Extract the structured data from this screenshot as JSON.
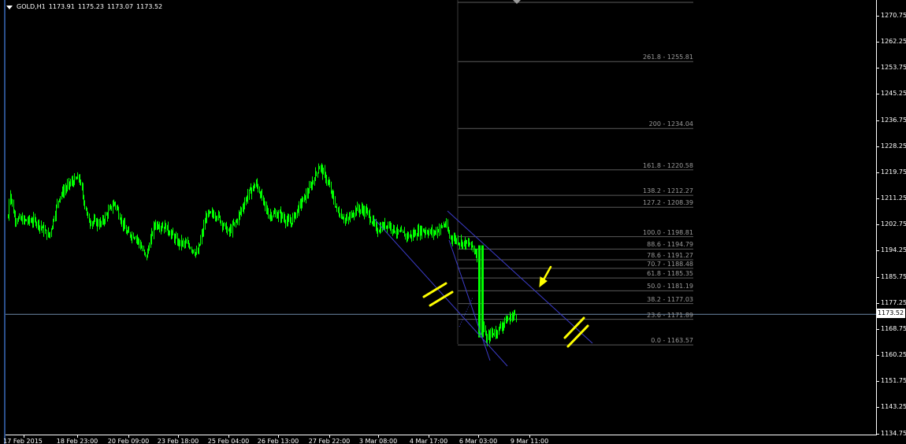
{
  "header": {
    "symbol": "GOLD,H1",
    "open": "1173.91",
    "high": "1175.23",
    "low": "1173.07",
    "close": "1173.52"
  },
  "price_axis": {
    "labels": [
      "1270.75",
      "1262.25",
      "1253.75",
      "1245.25",
      "1236.75",
      "1228.25",
      "1219.75",
      "1211.25",
      "1202.75",
      "1194.25",
      "1185.75",
      "1177.25",
      "1168.75",
      "1160.25",
      "1151.75",
      "1143.25",
      "1134.75"
    ],
    "current_price": "1173.52"
  },
  "time_axis": {
    "labels": [
      "17 Feb 2015",
      "18 Feb 23:00",
      "20 Feb 09:00",
      "23 Feb 18:00",
      "25 Feb 04:00",
      "26 Feb 13:00",
      "27 Feb 22:00",
      "3 Mar 08:00",
      "4 Mar 17:00",
      "6 Mar 03:00",
      "9 Mar 11:00"
    ]
  },
  "fibonacci": {
    "levels": [
      {
        "label": "261.8 - 1255.81",
        "price": 1255.81
      },
      {
        "label": "200 - 1234.04",
        "price": 1234.04
      },
      {
        "label": "161.8 - 1220.58",
        "price": 1220.58
      },
      {
        "label": "138.2 - 1212.27",
        "price": 1212.27
      },
      {
        "label": "127.2 - 1208.39",
        "price": 1208.39
      },
      {
        "label": "100.0 - 1198.81",
        "price": 1198.81
      },
      {
        "label": "88.6 - 1194.79",
        "price": 1194.79
      },
      {
        "label": "78.6 - 1191.27",
        "price": 1191.27
      },
      {
        "label": "70.7 - 1188.48",
        "price": 1188.48
      },
      {
        "label": "61.8 - 1185.35",
        "price": 1185.35
      },
      {
        "label": "50.0 - 1181.19",
        "price": 1181.19
      },
      {
        "label": "38.2 - 1177.03",
        "price": 1177.03
      },
      {
        "label": "23.6 - 1171.89",
        "price": 1171.89
      },
      {
        "label": "0.0 - 1163.57",
        "price": 1163.57
      }
    ]
  },
  "colors": {
    "background": "#000000",
    "candles": "#00ff00",
    "fib_lines": "#5a5a5a",
    "fib_text": "#9a9a9a",
    "trendlines": "#3c3cc8",
    "current_price_line": "#6e8aa8",
    "annotations": "#ffff00",
    "axis": "#ffffff"
  },
  "chart_data": {
    "type": "candlestick",
    "symbol": "GOLD",
    "timeframe": "H1",
    "ylim": [
      1134.75,
      1274
    ],
    "x": [
      "17 Feb 2015",
      "18 Feb 23:00",
      "20 Feb 09:00",
      "23 Feb 18:00",
      "25 Feb 04:00",
      "26 Feb 13:00",
      "27 Feb 22:00",
      "3 Mar 08:00",
      "4 Mar 17:00",
      "6 Mar 03:00",
      "9 Mar 11:00"
    ],
    "close_approx": [
      1205,
      1214,
      1206,
      1201,
      1206,
      1210,
      1218,
      1204,
      1203,
      1180,
      1173.52
    ],
    "last_bar": {
      "open": 1173.91,
      "high": 1175.23,
      "low": 1173.07,
      "close": 1173.52
    }
  }
}
